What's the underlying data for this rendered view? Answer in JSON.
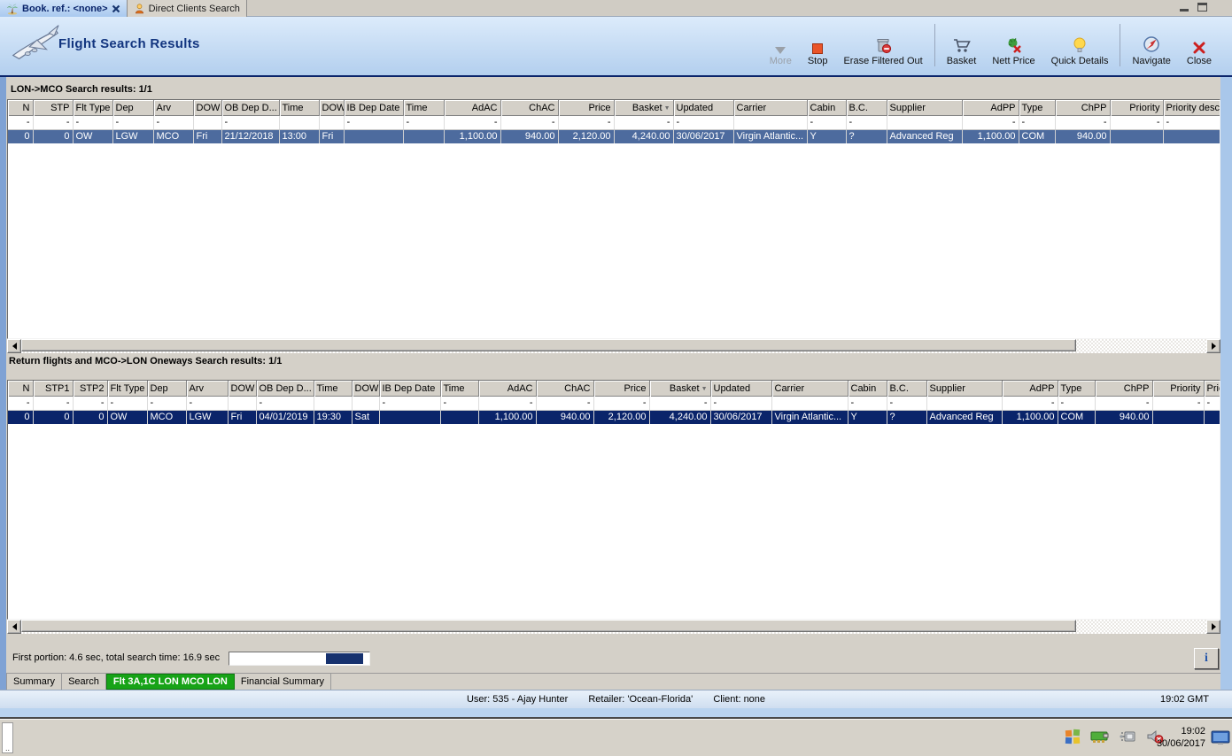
{
  "window_tabs": [
    {
      "label": "Book. ref.: <none>"
    },
    {
      "label": "Direct Clients Search"
    }
  ],
  "header": {
    "title": "Flight Search Results"
  },
  "toolbar": {
    "more": "More",
    "stop": "Stop",
    "erase": "Erase Filtered Out",
    "basket": "Basket",
    "nett_price": "Nett Price",
    "quick_details": "Quick Details",
    "navigate": "Navigate",
    "close": "Close"
  },
  "grids": [
    {
      "title": "LON->MCO Search results: 1/1",
      "sort_column": "Basket",
      "columns": [
        "N",
        "STP",
        "Flt Type",
        "Dep",
        "Arv",
        "DOW",
        "OB Dep D...",
        "Time",
        "DOW",
        "IB Dep Date",
        "Time",
        "AdAC",
        "ChAC",
        "Price",
        "Basket",
        "Updated",
        "Carrier",
        "Cabin",
        "B.C.",
        "Supplier",
        "AdPP",
        "Type",
        "ChPP",
        "Priority",
        "Priority descr"
      ],
      "filter": [
        "-",
        "-",
        "-",
        "-",
        "-",
        "",
        "-",
        "",
        "",
        "-",
        "-",
        "-",
        "-",
        "-",
        "-",
        "-",
        "",
        "-",
        "-",
        "",
        "-",
        "-",
        "-",
        "-",
        "-"
      ],
      "rows": [
        [
          "0",
          "0",
          "OW",
          "LGW",
          "MCO",
          "Fri",
          "21/12/2018",
          "13:00",
          "Fri",
          "",
          "",
          "1,100.00",
          "940.00",
          "2,120.00",
          "4,240.00",
          "30/06/2017",
          "Virgin Atlantic...",
          "Y",
          "?",
          "Advanced Reg",
          "1,100.00",
          "COM",
          "940.00",
          "",
          ""
        ]
      ]
    },
    {
      "title": "Return flights and MCO->LON Oneways Search results: 1/1",
      "sort_column": "Basket",
      "columns": [
        "N",
        "STP1",
        "STP2",
        "Flt Type",
        "Dep",
        "Arv",
        "DOW",
        "OB Dep D...",
        "Time",
        "DOW",
        "IB Dep Date",
        "Time",
        "AdAC",
        "ChAC",
        "Price",
        "Basket",
        "Updated",
        "Carrier",
        "Cabin",
        "B.C.",
        "Supplier",
        "AdPP",
        "Type",
        "ChPP",
        "Priority",
        "Prior..."
      ],
      "filter": [
        "-",
        "-",
        "-",
        "-",
        "-",
        "-",
        "",
        "-",
        "",
        "",
        "-",
        "-",
        "-",
        "-",
        "-",
        "-",
        "-",
        "",
        "-",
        "-",
        "",
        "-",
        "-",
        "-",
        "-",
        "-"
      ],
      "rows": [
        [
          "0",
          "0",
          "0",
          "OW",
          "MCO",
          "LGW",
          "Fri",
          "04/01/2019",
          "19:30",
          "Sat",
          "",
          "",
          "1,100.00",
          "940.00",
          "2,120.00",
          "4,240.00",
          "30/06/2017",
          "Virgin Atlantic...",
          "Y",
          "?",
          "Advanced Reg",
          "1,100.00",
          "COM",
          "940.00",
          "",
          ""
        ]
      ]
    }
  ],
  "progress": {
    "label": "First portion: 4.6 sec, total search time: 16.9 sec",
    "info_button": "i"
  },
  "bottom_tabs": [
    {
      "label": "Summary"
    },
    {
      "label": "Search"
    },
    {
      "label": "Flt 3A,1C LON MCO LON"
    },
    {
      "label": "Financial Summary"
    }
  ],
  "status_bar": {
    "user": "User: 535 - Ajay Hunter",
    "retailer": "Retailer: 'Ocean-Florida'",
    "client": "Client: none",
    "time": "19:02 GMT"
  },
  "taskbar": {
    "time": "19:02",
    "date": "30/06/2017"
  },
  "colors": {
    "accent_navy": "#0a246a",
    "row_selected_active": "#0a246a",
    "row_selected_inactive": "#4d6b9e",
    "active_bottom_tab_green": "#17a317"
  }
}
